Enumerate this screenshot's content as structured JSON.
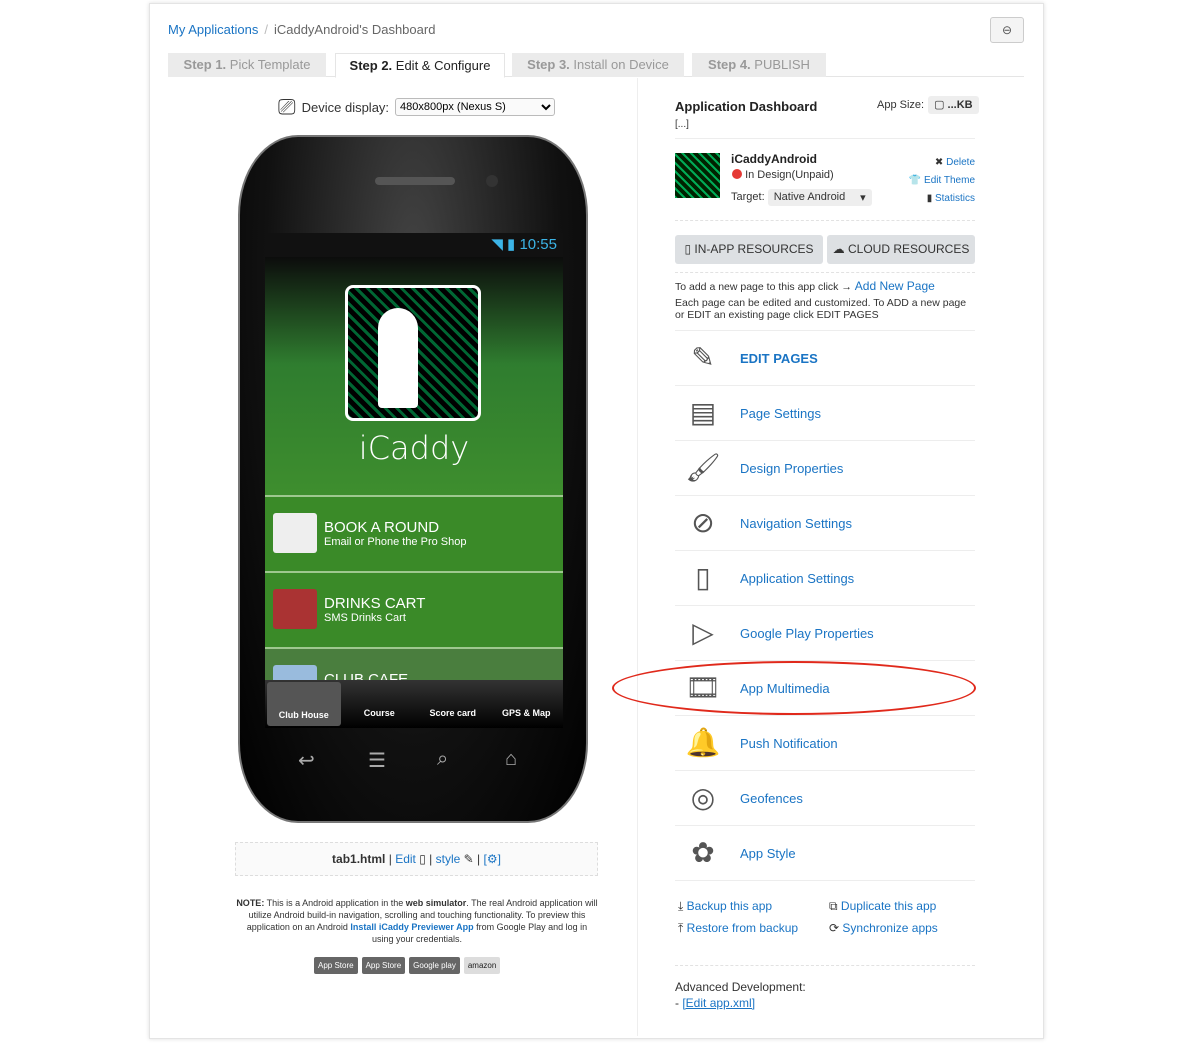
{
  "breadcrumb": {
    "root": "My Applications",
    "current": "iCaddyAndroid's Dashboard"
  },
  "tabs": [
    {
      "step": "Step 1.",
      "label": "Pick Template"
    },
    {
      "step": "Step 2.",
      "label": "Edit & Configure"
    },
    {
      "step": "Step 3.",
      "label": "Install on Device"
    },
    {
      "step": "Step 4.",
      "label": "PUBLISH"
    }
  ],
  "device": {
    "label": "Device display:",
    "value": "480x800px (Nexus S)"
  },
  "phone": {
    "time": "10:55",
    "app_title": "iCaddy",
    "rows": [
      {
        "title": "BOOK A ROUND",
        "sub": "Email or Phone the Pro Shop"
      },
      {
        "title": "DRINKS CART",
        "sub": "SMS Drinks Cart"
      },
      {
        "title": "CLUB CAFE",
        "sub": ""
      }
    ],
    "tabbar": [
      "Club House",
      "Course",
      "Score card",
      "GPS & Map"
    ]
  },
  "filebar": {
    "file": "tab1.html",
    "edit": "Edit",
    "style": "style",
    "gear": "[⚙]"
  },
  "note": {
    "bold": "NOTE:",
    "t1": " This is a Android application in the ",
    "b2": "web simulator",
    "t2": ". The real Android application will utilize Android build-in navigation, scrolling and touching functionality. To preview this application on an Android ",
    "link": "Install iCaddy Previewer App",
    "t3": " from Google Play and log in using your credentials."
  },
  "stores": [
    "App Store",
    "App Store",
    "Google play",
    "amazon"
  ],
  "dashboard": {
    "title": "Application Dashboard",
    "ellipsis": "[...]",
    "size_label": "App Size:",
    "size_value": "...KB",
    "app_name": "iCaddyAndroid",
    "status": "In Design(Unpaid)",
    "status_color": "#e53935",
    "target_label": "Target:",
    "target_value": "Native Android",
    "actions": [
      "Delete",
      "Edit Theme",
      "Statistics"
    ],
    "resources": [
      "IN-APP RESOURCES",
      "CLOUD RESOURCES"
    ],
    "add_text": "To add a new page to this app click →",
    "add_link": "Add New Page",
    "help": "Each page can be edited and customized. To ADD a new page or EDIT an existing page click EDIT PAGES",
    "menu": [
      {
        "label": "EDIT PAGES",
        "icon": "pencil-icon"
      },
      {
        "label": "Page Settings",
        "icon": "page-settings-icon"
      },
      {
        "label": "Design Properties",
        "icon": "css-brush-icon"
      },
      {
        "label": "Navigation Settings",
        "icon": "compass-icon"
      },
      {
        "label": "Application Settings",
        "icon": "phone-gear-icon"
      },
      {
        "label": "Google Play Properties",
        "icon": "play-icon"
      },
      {
        "label": "App Multimedia",
        "icon": "multimedia-icon"
      },
      {
        "label": "Push Notification",
        "icon": "bell-icon"
      },
      {
        "label": "Geofences",
        "icon": "geofence-icon"
      },
      {
        "label": "App Style",
        "icon": "palette-icon"
      }
    ],
    "tools": [
      "Backup this app",
      "Duplicate this app",
      "Restore from backup",
      "Synchronize apps"
    ],
    "adv_label": "Advanced Development:",
    "adv_link": "[Edit app.xml]"
  },
  "highlight_color": "#e0291b"
}
